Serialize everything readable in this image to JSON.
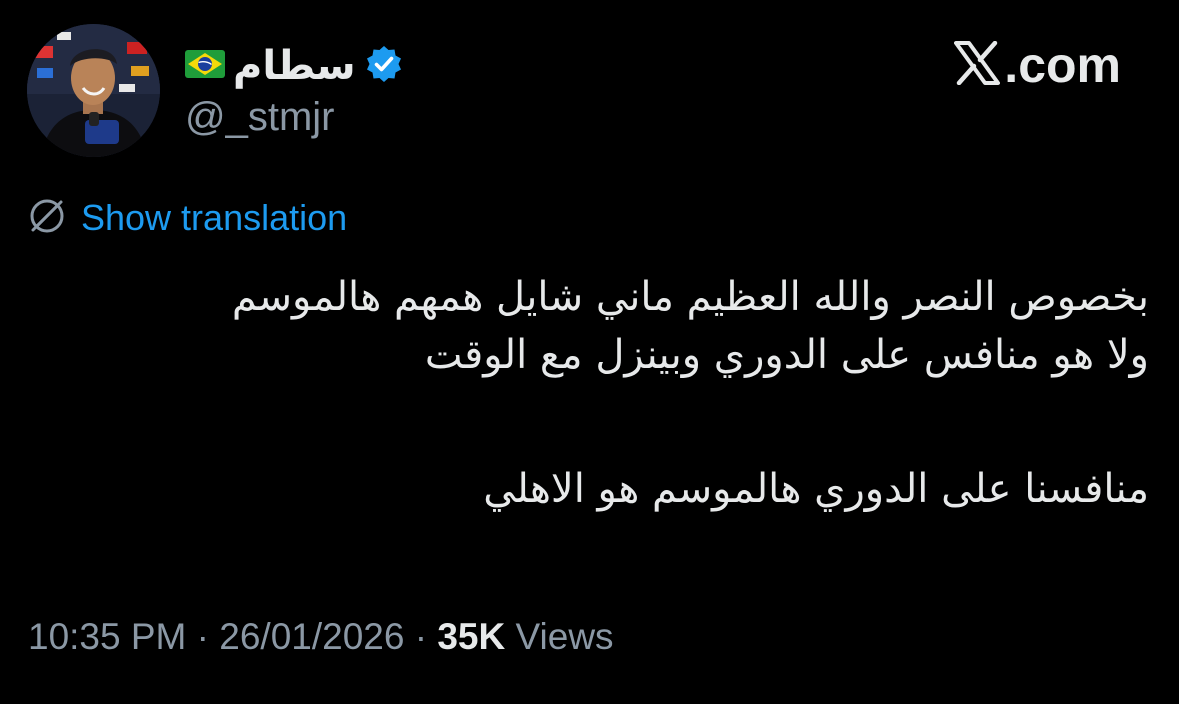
{
  "author": {
    "display_name": "سطام",
    "flag_icon": "brazil-flag-icon",
    "verified_icon": "verified-badge-icon",
    "handle": "@_stmjr",
    "avatar_icon": "profile-avatar"
  },
  "brand": {
    "logo_icon": "x-logo-icon",
    "text": ".com"
  },
  "translation": {
    "icon": "translate-globe-icon",
    "label": "Show translation"
  },
  "tweet": {
    "lines": [
      "بخصوص النصر والله العظيم ماني شايل همهم هالموسم",
      "ولا هو منافس على الدوري وبينزل مع الوقت",
      "منافسنا على الدوري هالموسم هو الاهلي"
    ]
  },
  "meta": {
    "time": "10:35 PM",
    "separator": "·",
    "date": "26/01/2026",
    "views_count": "35K",
    "views_label": "Views"
  },
  "colors": {
    "background": "#000000",
    "text": "#e7e9ea",
    "secondary": "#8b98a5",
    "link": "#1d9bf0",
    "verified": "#1d9bf0"
  }
}
